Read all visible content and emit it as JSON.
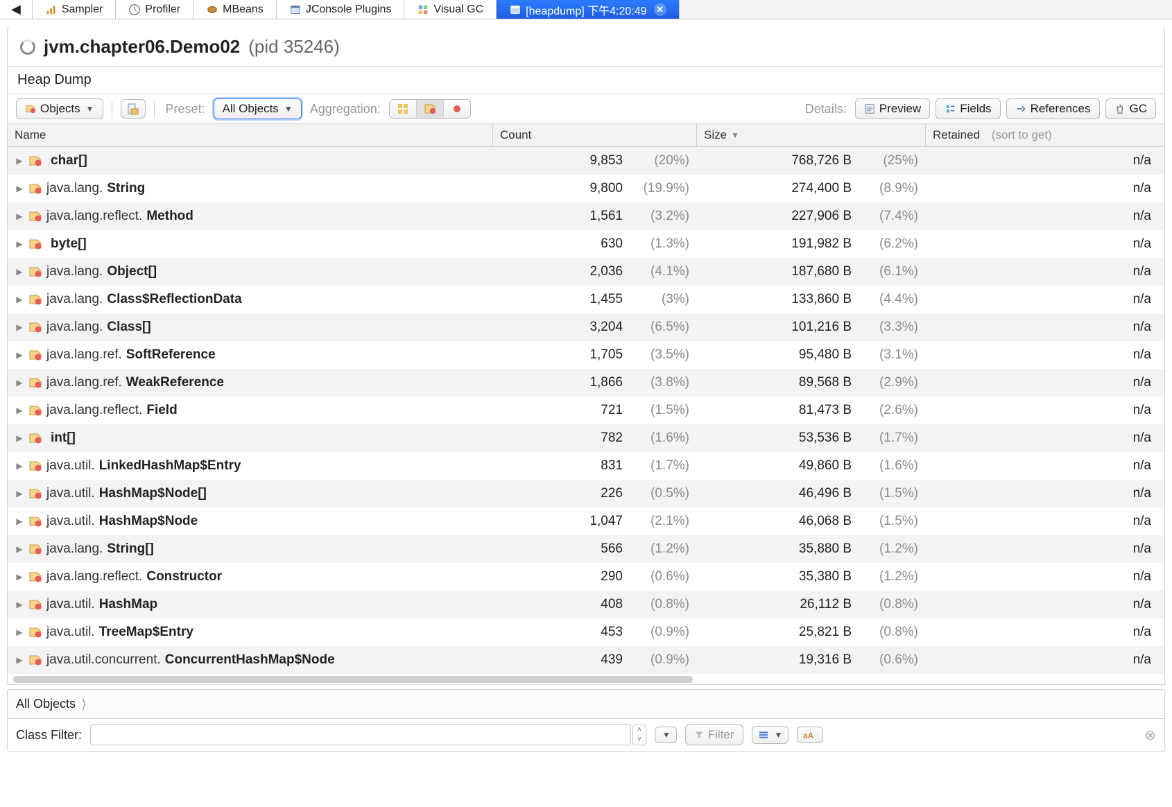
{
  "tabs": [
    {
      "label": "Sampler"
    },
    {
      "label": "Profiler"
    },
    {
      "label": "MBeans"
    },
    {
      "label": "JConsole Plugins"
    },
    {
      "label": "Visual GC"
    },
    {
      "label": "[heapdump] 下午4:20:49",
      "active": true
    }
  ],
  "title": {
    "main": "jvm.chapter06.Demo02",
    "pid": "(pid 35246)"
  },
  "subbar": "Heap Dump",
  "toolbar": {
    "objects": "Objects",
    "preset_label": "Preset:",
    "preset_value": "All Objects",
    "aggregation_label": "Aggregation:",
    "details_label": "Details:",
    "preview": "Preview",
    "fields": "Fields",
    "references": "References",
    "gc": "GC"
  },
  "columns": {
    "name": "Name",
    "count": "Count",
    "size": "Size",
    "retained": "Retained",
    "retained_hint": "(sort to get)"
  },
  "rows": [
    {
      "pkg": "",
      "cls": "char[]",
      "count": "9,853",
      "count_pct": "(20%)",
      "size": "768,726 B",
      "size_pct": "(25%)",
      "ret": "n/a"
    },
    {
      "pkg": "java.lang.",
      "cls": "String",
      "count": "9,800",
      "count_pct": "(19.9%)",
      "size": "274,400 B",
      "size_pct": "(8.9%)",
      "ret": "n/a"
    },
    {
      "pkg": "java.lang.reflect.",
      "cls": "Method",
      "count": "1,561",
      "count_pct": "(3.2%)",
      "size": "227,906 B",
      "size_pct": "(7.4%)",
      "ret": "n/a"
    },
    {
      "pkg": "",
      "cls": "byte[]",
      "count": "630",
      "count_pct": "(1.3%)",
      "size": "191,982 B",
      "size_pct": "(6.2%)",
      "ret": "n/a"
    },
    {
      "pkg": "java.lang.",
      "cls": "Object[]",
      "count": "2,036",
      "count_pct": "(4.1%)",
      "size": "187,680 B",
      "size_pct": "(6.1%)",
      "ret": "n/a"
    },
    {
      "pkg": "java.lang.",
      "cls": "Class$ReflectionData",
      "count": "1,455",
      "count_pct": "(3%)",
      "size": "133,860 B",
      "size_pct": "(4.4%)",
      "ret": "n/a"
    },
    {
      "pkg": "java.lang.",
      "cls": "Class[]",
      "count": "3,204",
      "count_pct": "(6.5%)",
      "size": "101,216 B",
      "size_pct": "(3.3%)",
      "ret": "n/a"
    },
    {
      "pkg": "java.lang.ref.",
      "cls": "SoftReference",
      "count": "1,705",
      "count_pct": "(3.5%)",
      "size": "95,480 B",
      "size_pct": "(3.1%)",
      "ret": "n/a"
    },
    {
      "pkg": "java.lang.ref.",
      "cls": "WeakReference",
      "count": "1,866",
      "count_pct": "(3.8%)",
      "size": "89,568 B",
      "size_pct": "(2.9%)",
      "ret": "n/a"
    },
    {
      "pkg": "java.lang.reflect.",
      "cls": "Field",
      "count": "721",
      "count_pct": "(1.5%)",
      "size": "81,473 B",
      "size_pct": "(2.6%)",
      "ret": "n/a"
    },
    {
      "pkg": "",
      "cls": "int[]",
      "count": "782",
      "count_pct": "(1.6%)",
      "size": "53,536 B",
      "size_pct": "(1.7%)",
      "ret": "n/a"
    },
    {
      "pkg": "java.util.",
      "cls": "LinkedHashMap$Entry",
      "count": "831",
      "count_pct": "(1.7%)",
      "size": "49,860 B",
      "size_pct": "(1.6%)",
      "ret": "n/a"
    },
    {
      "pkg": "java.util.",
      "cls": "HashMap$Node[]",
      "count": "226",
      "count_pct": "(0.5%)",
      "size": "46,496 B",
      "size_pct": "(1.5%)",
      "ret": "n/a"
    },
    {
      "pkg": "java.util.",
      "cls": "HashMap$Node",
      "count": "1,047",
      "count_pct": "(2.1%)",
      "size": "46,068 B",
      "size_pct": "(1.5%)",
      "ret": "n/a"
    },
    {
      "pkg": "java.lang.",
      "cls": "String[]",
      "count": "566",
      "count_pct": "(1.2%)",
      "size": "35,880 B",
      "size_pct": "(1.2%)",
      "ret": "n/a"
    },
    {
      "pkg": "java.lang.reflect.",
      "cls": "Constructor",
      "count": "290",
      "count_pct": "(0.6%)",
      "size": "35,380 B",
      "size_pct": "(1.2%)",
      "ret": "n/a"
    },
    {
      "pkg": "java.util.",
      "cls": "HashMap",
      "count": "408",
      "count_pct": "(0.8%)",
      "size": "26,112 B",
      "size_pct": "(0.8%)",
      "ret": "n/a"
    },
    {
      "pkg": "java.util.",
      "cls": "TreeMap$Entry",
      "count": "453",
      "count_pct": "(0.9%)",
      "size": "25,821 B",
      "size_pct": "(0.8%)",
      "ret": "n/a"
    },
    {
      "pkg": "java.util.concurrent.",
      "cls": "ConcurrentHashMap$Node",
      "count": "439",
      "count_pct": "(0.9%)",
      "size": "19,316 B",
      "size_pct": "(0.6%)",
      "ret": "n/a"
    }
  ],
  "crumb": "All Objects",
  "filter": {
    "label": "Class Filter:",
    "value": "",
    "placeholder": "",
    "button": "Filter"
  }
}
